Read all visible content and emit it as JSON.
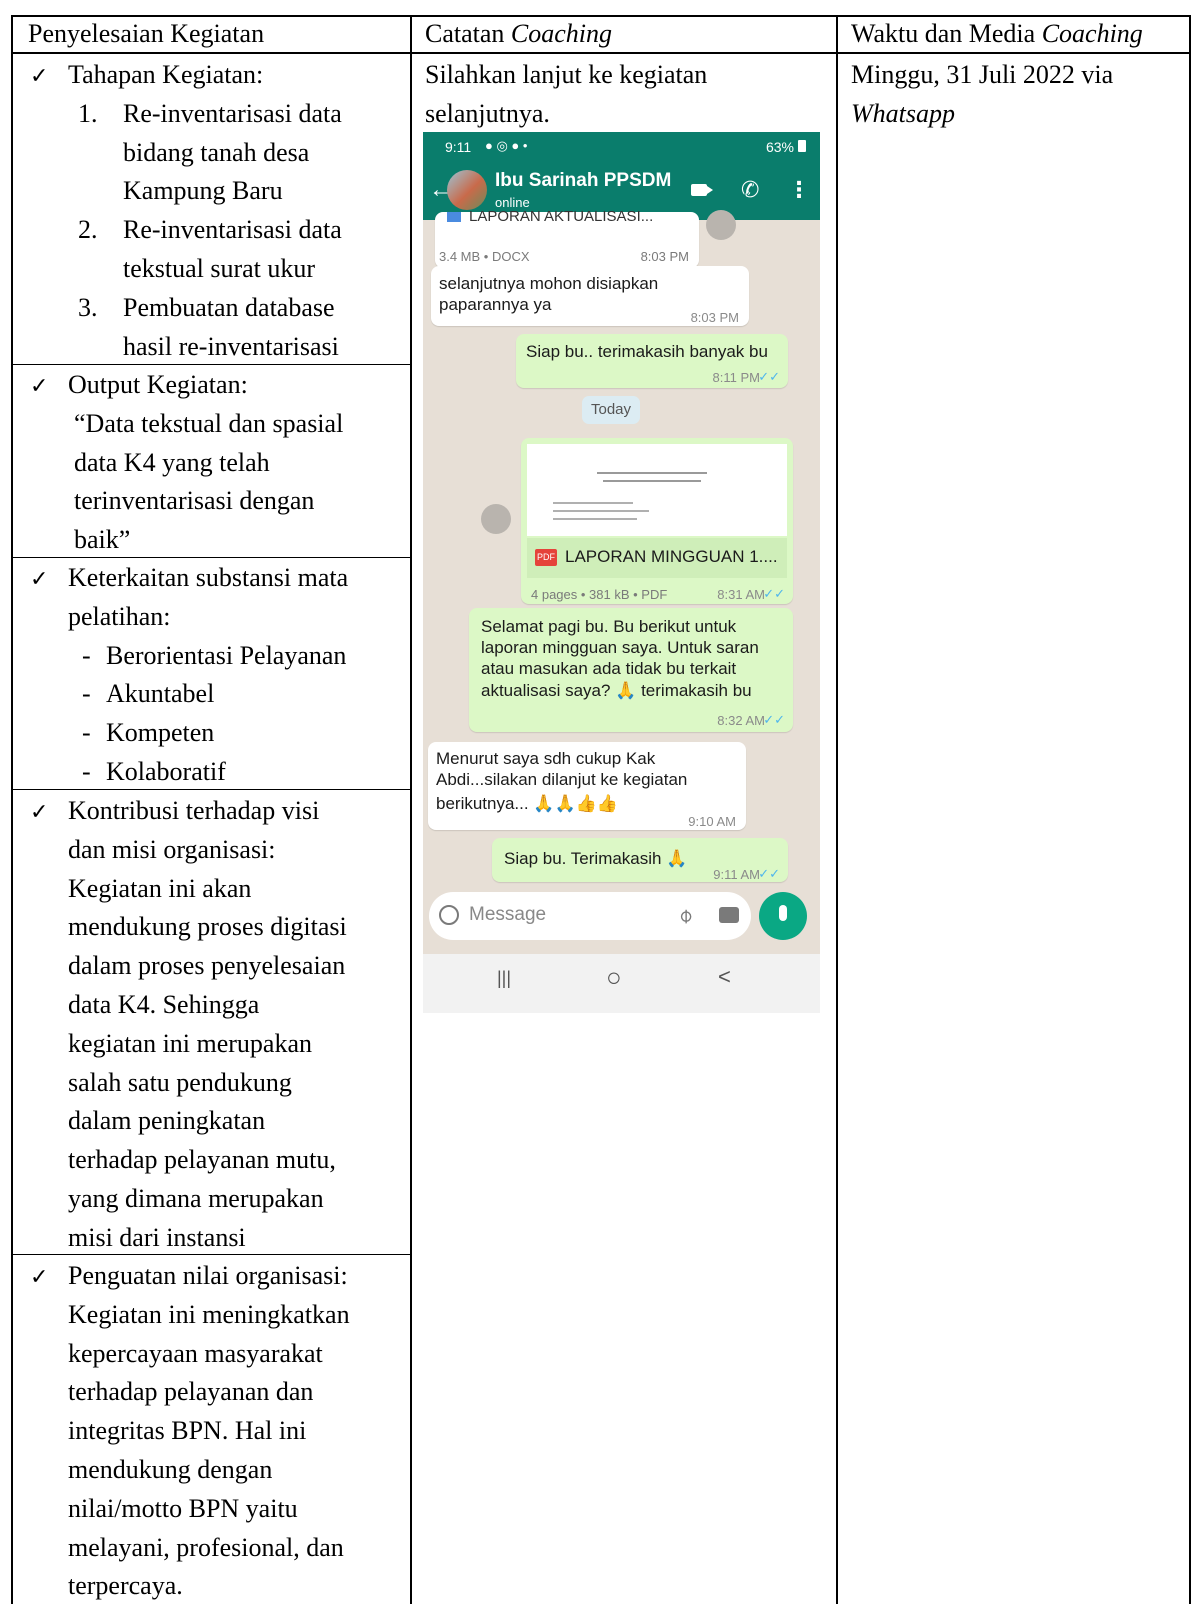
{
  "headers": {
    "col1": "Penyelesaian Kegiatan",
    "col2_plain": "Catatan ",
    "col2_italic": "Coaching",
    "col3_plain": "Waktu dan Media ",
    "col3_italic": "Coaching"
  },
  "col1": {
    "check": "✓",
    "tahapan_title": "Tahapan Kegiatan:",
    "tahapan_items": [
      {
        "num": "1.",
        "lines": [
          "Re-inventarisasi data",
          "bidang tanah desa",
          "Kampung Baru"
        ]
      },
      {
        "num": "2.",
        "lines": [
          "Re-inventarisasi data",
          "tekstual surat ukur"
        ]
      },
      {
        "num": "3.",
        "lines": [
          "Pembuatan database",
          "hasil re-inventarisasi"
        ]
      }
    ],
    "output_title": "Output Kegiatan:",
    "output_lines": [
      "“Data tekstual dan spasial",
      "data K4 yang telah",
      "terinventarisasi dengan",
      "baik”"
    ],
    "keterkaitan_lines": [
      "Keterkaitan substansi mata",
      "pelatihan:"
    ],
    "keterkaitan_items": [
      "Berorientasi Pelayanan",
      "Akuntabel",
      "Kompeten",
      "Kolaboratif"
    ],
    "dash": "-",
    "kontribusi_lines": [
      "Kontribusi terhadap visi",
      "dan misi organisasi:",
      "Kegiatan ini akan",
      "mendukung proses digitasi",
      "dalam proses penyelesaian",
      "data K4.  Sehingga",
      "kegiatan ini merupakan",
      "salah satu pendukung",
      "dalam peningkatan",
      "terhadap pelayanan mutu,",
      "yang dimana merupakan",
      "misi dari instansi"
    ],
    "penguatan_lines": [
      "Penguatan nilai organisasi:",
      "Kegiatan ini meningkatkan",
      "kepercayaan masyarakat",
      "terhadap pelayanan dan",
      "integritas BPN. Hal ini",
      "mendukung dengan",
      "nilai/motto BPN yaitu",
      "melayani, profesional, dan",
      "terpercaya."
    ]
  },
  "col2": {
    "note_line1": "Silahkan lanjut ke kegiatan",
    "note_line2": "selanjutnya."
  },
  "col3": {
    "line1": "Minggu, 31 Juli 2022 via",
    "line2": "Whatsapp"
  },
  "phone": {
    "status_time": "9:11",
    "status_right": "63%",
    "contact_name": "Ibu Sarinah PPSDM",
    "contact_status": "online",
    "cut_doc_title": "LAPORAN AKTUALISASI...",
    "doc_meta": "3.4 MB • DOCX",
    "doc_time": "8:03 PM",
    "msg1_lines": [
      "selanjutnya mohon disiapkan",
      "paparannya ya"
    ],
    "msg1_time": "8:03 PM",
    "msg2": "Siap bu.. terimakasih banyak bu",
    "msg2_time": "8:11 PM",
    "date_chip": "Today",
    "pdf_badge": "PDF",
    "pdf_title": "LAPORAN MINGGUAN 1....",
    "pdf_meta": "4 pages • 381 kB • PDF",
    "pdf_time": "8:31 AM",
    "msg3_lines": [
      "Selamat pagi bu. Bu berikut untuk",
      "laporan mingguan saya. Untuk saran",
      "atau masukan ada tidak bu terkait",
      "aktualisasi saya? 🙏 terimakasih bu"
    ],
    "msg3_time": "8:32 AM",
    "msg4_lines": [
      "Menurut saya sdh cukup Kak",
      "Abdi...silakan dilanjut ke kegiatan",
      "berikutnya... 🙏🙏👍👍"
    ],
    "msg4_time": "9:10 AM",
    "msg5": "Siap bu. Terimakasih 🙏",
    "msg5_time": "9:11 AM",
    "input_placeholder": "Message",
    "nav_recent": "|||",
    "nav_home": "○",
    "nav_back": "<"
  }
}
